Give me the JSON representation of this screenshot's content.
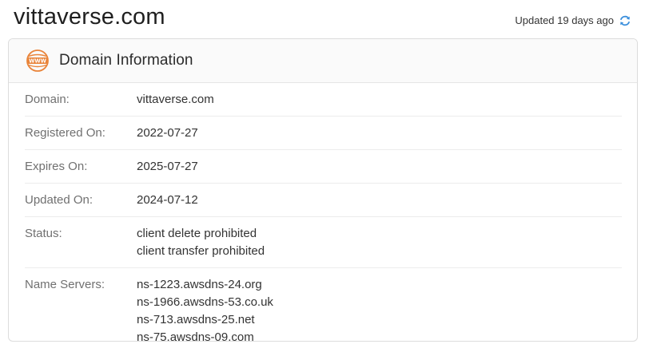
{
  "page": {
    "title": "vittaverse.com",
    "updated_text": "Updated 19 days ago"
  },
  "card": {
    "title": "Domain Information",
    "rows": [
      {
        "label": "Domain:",
        "values": [
          "vittaverse.com"
        ]
      },
      {
        "label": "Registered On:",
        "values": [
          "2022-07-27"
        ]
      },
      {
        "label": "Expires On:",
        "values": [
          "2025-07-27"
        ]
      },
      {
        "label": "Updated On:",
        "values": [
          "2024-07-12"
        ]
      },
      {
        "label": "Status:",
        "values": [
          "client delete prohibited",
          "client transfer prohibited"
        ]
      },
      {
        "label": "Name Servers:",
        "values": [
          "ns-1223.awsdns-24.org",
          "ns-1966.awsdns-53.co.uk",
          "ns-713.awsdns-25.net",
          "ns-75.awsdns-09.com"
        ]
      }
    ]
  },
  "icons": {
    "refresh": "refresh-icon",
    "www": "www-globe-icon"
  },
  "colors": {
    "accent_orange": "#e9843a",
    "refresh_blue": "#3b8fdc"
  }
}
